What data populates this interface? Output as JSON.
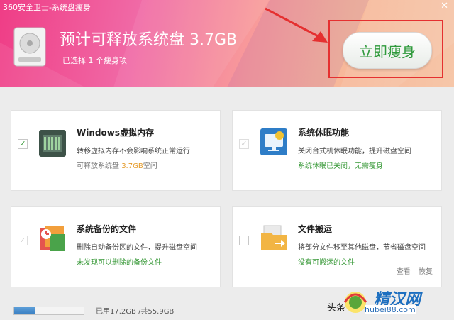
{
  "window": {
    "title": "360安全卫士-系统盘瘦身",
    "minimize": "—",
    "close": "✕"
  },
  "header": {
    "title": "预计可释放系统盘 3.7GB",
    "subtitle": "已选择 1 个瘦身项",
    "action_label": "立即瘦身",
    "colors": {
      "gradient_start": "#ef3d86",
      "gradient_end": "#f6c6a8",
      "accent_green": "#2f9a3c"
    }
  },
  "cards": [
    {
      "title": "Windows虚拟内存",
      "desc": "转移虚拟内存不会影响系统正常运行",
      "stat_prefix": "可释放系统盘 ",
      "stat_value": "3.7GB",
      "stat_suffix": "空间",
      "checked": true,
      "icon": "memory-chip-icon"
    },
    {
      "title": "系统休眠功能",
      "desc": "关闭台式机休眠功能，提升磁盘空间",
      "stat": "系统休眠已关闭，无需瘦身",
      "checked": false,
      "icon": "monitor-sleep-icon"
    },
    {
      "title": "系统备份的文件",
      "desc": "删除自动备份区的文件，提升磁盘空间",
      "stat": "未发现可以删除的备份文件",
      "checked": false,
      "icon": "backup-files-icon"
    },
    {
      "title": "文件搬运",
      "desc": "将部分文件移至其他磁盘，节省磁盘空间",
      "stat": "没有可搬运的文件",
      "checked": false,
      "icon": "folder-move-icon",
      "links": [
        "查看",
        "恢复"
      ]
    }
  ],
  "footer": {
    "disk_usage": "已用17.2GB /共55.9GB",
    "used_fraction": 0.31
  },
  "watermark": {
    "left": "头条",
    "brand": "精汉网",
    "url": "hubei88.com"
  }
}
